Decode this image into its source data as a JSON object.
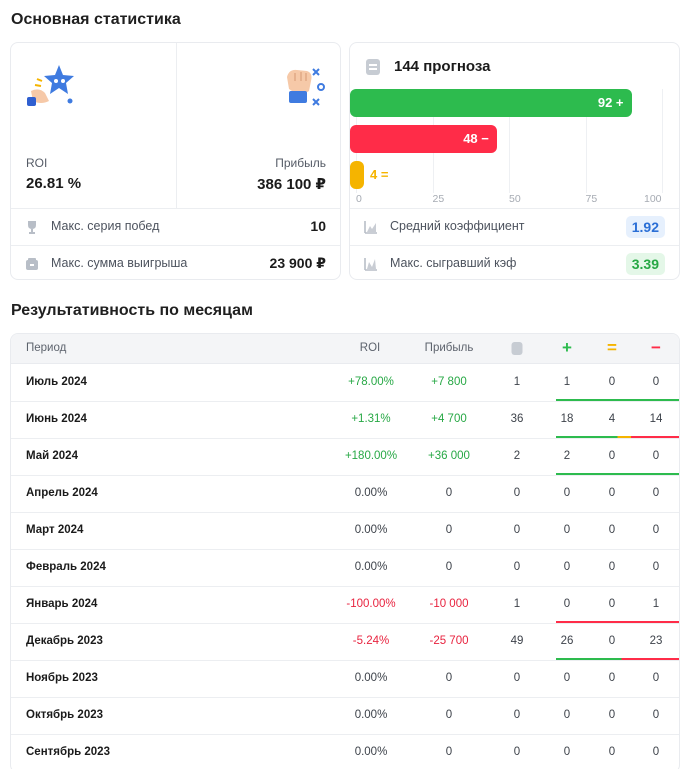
{
  "main_stats": {
    "title": "Основная статистика",
    "roi_label": "ROI",
    "roi_value": "26.81 %",
    "profit_label": "Прибыль",
    "profit_value": "386 100 ₽",
    "rows": [
      {
        "label": "Макс. серия побед",
        "value": "10",
        "icon": "trophy-icon"
      },
      {
        "label": "Макс. сумма выигрыша",
        "value": "23 900 ₽",
        "icon": "wallet-icon"
      }
    ]
  },
  "forecasts": {
    "title": "144 прогноза",
    "colors": {
      "win": "#2dbb4e",
      "loss": "#ff2c48",
      "draw": "#f5b400"
    },
    "ticks": [
      "0",
      "25",
      "50",
      "75",
      "100"
    ],
    "bars": [
      {
        "label": "92 +",
        "value": 92
      },
      {
        "label": "48 −",
        "value": 48
      },
      {
        "label": "4 =",
        "value": 4
      }
    ],
    "rows": [
      {
        "label": "Средний коэффициент",
        "value": "1.92",
        "icon": "chart-icon"
      },
      {
        "label": "Макс. сыгравший кэф",
        "value": "3.39",
        "icon": "chart-icon"
      }
    ]
  },
  "monthly": {
    "title": "Результативность по месяцам",
    "headers": {
      "period": "Период",
      "roi": "ROI",
      "profit": "Прибыль",
      "count_icon": "document-icon",
      "win": "+",
      "draw": "=",
      "loss": "−"
    },
    "rows": [
      {
        "period": "Июль 2024",
        "roi": "+78.00%",
        "profit": "+7 800",
        "total": "1",
        "win": "1",
        "draw": "0",
        "loss": "0",
        "trend": "pos"
      },
      {
        "period": "Июнь 2024",
        "roi": "+1.31%",
        "profit": "+4 700",
        "total": "36",
        "win": "18",
        "draw": "4",
        "loss": "14",
        "trend": "pos"
      },
      {
        "period": "Май 2024",
        "roi": "+180.00%",
        "profit": "+36 000",
        "total": "2",
        "win": "2",
        "draw": "0",
        "loss": "0",
        "trend": "pos"
      },
      {
        "period": "Апрель 2024",
        "roi": "0.00%",
        "profit": "0",
        "total": "0",
        "win": "0",
        "draw": "0",
        "loss": "0",
        "trend": "zero"
      },
      {
        "period": "Март 2024",
        "roi": "0.00%",
        "profit": "0",
        "total": "0",
        "win": "0",
        "draw": "0",
        "loss": "0",
        "trend": "zero"
      },
      {
        "period": "Февраль 2024",
        "roi": "0.00%",
        "profit": "0",
        "total": "0",
        "win": "0",
        "draw": "0",
        "loss": "0",
        "trend": "zero"
      },
      {
        "period": "Январь 2024",
        "roi": "-100.00%",
        "profit": "-10 000",
        "total": "1",
        "win": "0",
        "draw": "0",
        "loss": "1",
        "trend": "neg"
      },
      {
        "period": "Декабрь 2023",
        "roi": "-5.24%",
        "profit": "-25 700",
        "total": "49",
        "win": "26",
        "draw": "0",
        "loss": "23",
        "trend": "neg"
      },
      {
        "period": "Ноябрь 2023",
        "roi": "0.00%",
        "profit": "0",
        "total": "0",
        "win": "0",
        "draw": "0",
        "loss": "0",
        "trend": "zero"
      },
      {
        "period": "Октябрь 2023",
        "roi": "0.00%",
        "profit": "0",
        "total": "0",
        "win": "0",
        "draw": "0",
        "loss": "0",
        "trend": "zero"
      },
      {
        "period": "Сентябрь 2023",
        "roi": "0.00%",
        "profit": "0",
        "total": "0",
        "win": "0",
        "draw": "0",
        "loss": "0",
        "trend": "zero"
      }
    ]
  }
}
